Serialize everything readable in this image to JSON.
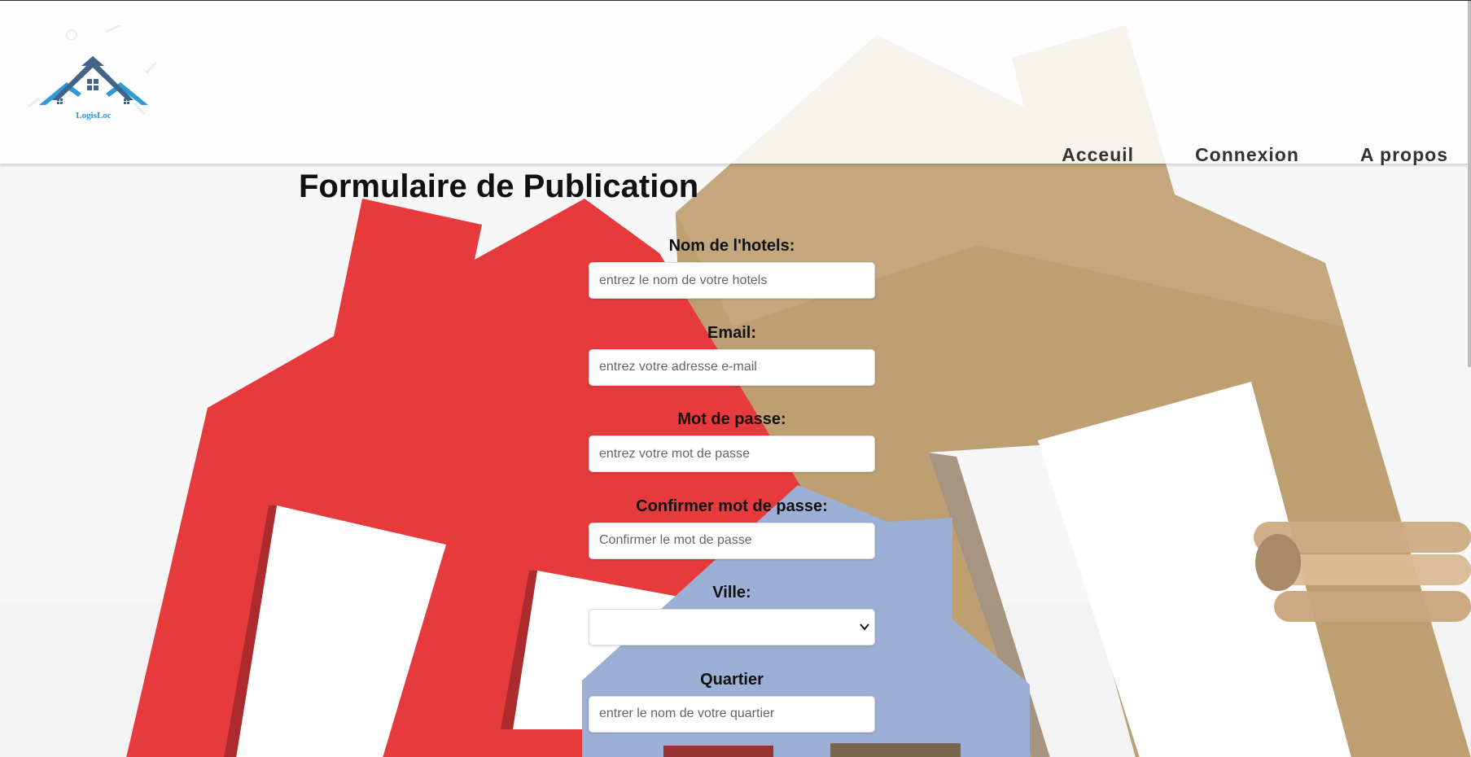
{
  "brand": {
    "name": "LogisLoc",
    "logo_icon": "house-roof-logo-icon",
    "colors": {
      "primary": "#2e9ad6",
      "dark": "#41658a"
    }
  },
  "nav": {
    "items": [
      {
        "label": "Acceuil"
      },
      {
        "label": "Connexion"
      },
      {
        "label": "A propos"
      }
    ]
  },
  "form": {
    "title": "Formulaire de Publication",
    "fields": [
      {
        "label": "Nom de l'hotels:",
        "type": "text",
        "placeholder": "entrez le nom de votre hotels",
        "value": ""
      },
      {
        "label": "Email:",
        "type": "email",
        "placeholder": "entrez votre adresse e-mail",
        "value": ""
      },
      {
        "label": "Mot de passe:",
        "type": "password",
        "placeholder": "entrez votre mot de passe",
        "value": ""
      },
      {
        "label": "Confirmer mot de passe:",
        "type": "password",
        "placeholder": "Confirmer le mot de passe",
        "value": ""
      },
      {
        "label": "Ville:",
        "type": "select",
        "selected": ""
      },
      {
        "label": "Quartier",
        "type": "text",
        "placeholder": "entrer le nom de votre quartier",
        "value": ""
      }
    ]
  }
}
